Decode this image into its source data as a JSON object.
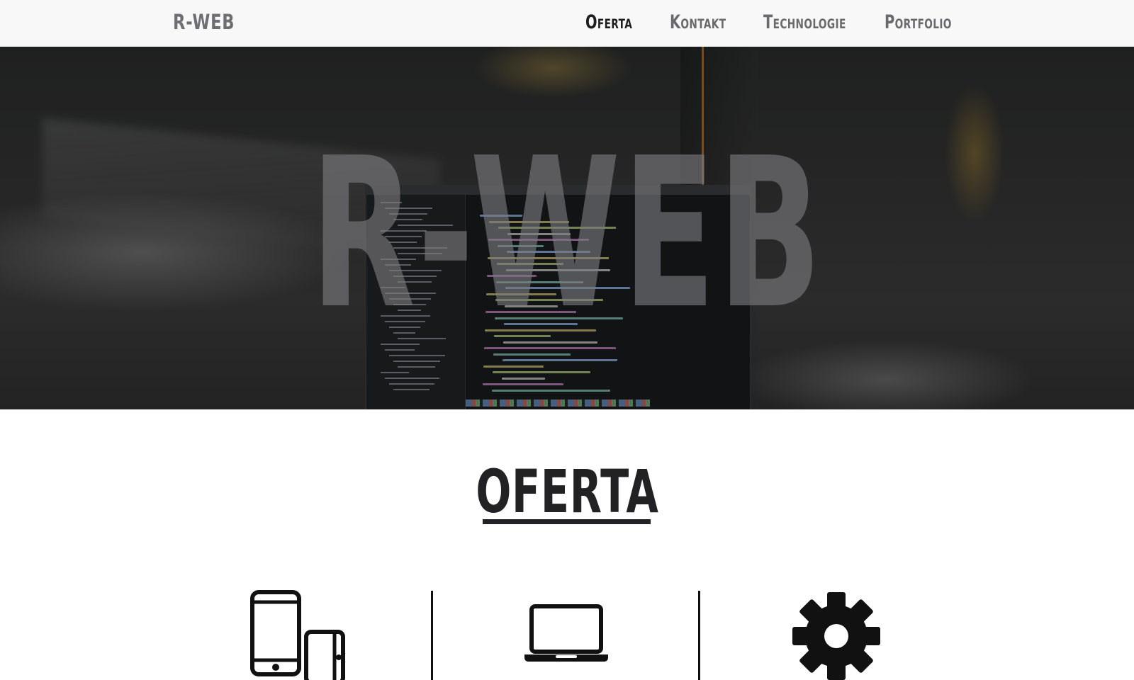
{
  "header": {
    "logo": "R-WEB",
    "nav": [
      {
        "label": "Oferta",
        "active": true
      },
      {
        "label": "Kontakt",
        "active": false
      },
      {
        "label": "Technologie",
        "active": false
      },
      {
        "label": "Portfolio",
        "active": false
      }
    ]
  },
  "hero": {
    "title": "R-WEB"
  },
  "offer": {
    "title": "OFERTA",
    "features": [
      {
        "icon": "mobile-devices-icon"
      },
      {
        "icon": "laptop-icon"
      },
      {
        "icon": "gear-icon"
      }
    ]
  },
  "colors": {
    "header_bg": "#f8f8f9",
    "nav_active": "#1e1e20",
    "nav_inactive": "#6a6a6e",
    "title_dark": "#222224"
  }
}
